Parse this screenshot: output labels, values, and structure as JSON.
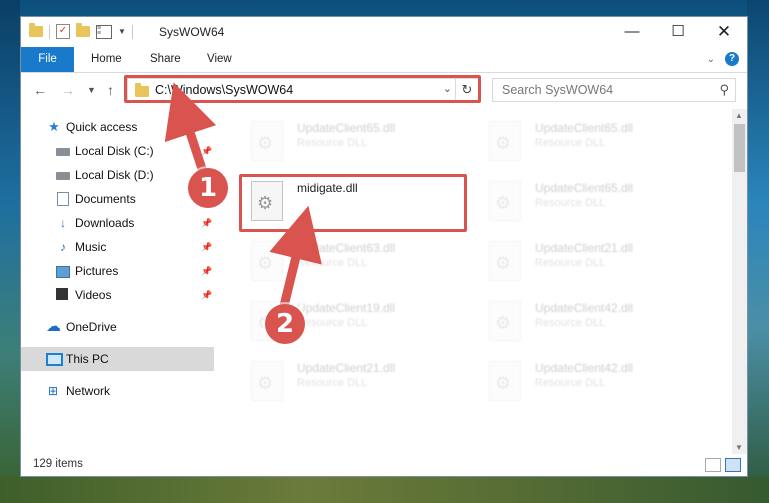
{
  "window": {
    "title": "SysWOW64",
    "controls": {
      "minimize": "—",
      "maximize": "☐",
      "close": "✕"
    }
  },
  "ribbon": {
    "tabs": [
      "File",
      "Home",
      "Share",
      "View"
    ]
  },
  "address_bar": {
    "path": "C:\\Windows\\SysWOW64",
    "search_placeholder": "Search SysWOW64"
  },
  "sidebar": {
    "quick_access": "Quick access",
    "items": [
      {
        "label": "Local Disk (C:)",
        "pinned": true
      },
      {
        "label": "Local Disk (D:)",
        "pinned": true
      },
      {
        "label": "Documents",
        "pinned": true
      },
      {
        "label": "Downloads",
        "pinned": true
      },
      {
        "label": "Music",
        "pinned": true
      },
      {
        "label": "Pictures",
        "pinned": true
      },
      {
        "label": "Videos",
        "pinned": true
      }
    ],
    "onedrive": "OneDrive",
    "this_pc": "This PC",
    "network": "Network"
  },
  "files": {
    "highlighted": {
      "name": "midigate.dll"
    },
    "background": [
      {
        "name": "UpdateClient65.dll",
        "type": "Resource DLL"
      },
      {
        "name": "UpdateClient65.dll",
        "type": "Resource DLL"
      },
      {
        "name": "UpdateClient65.dll",
        "type": "Resource DLL"
      },
      {
        "name": "UpdateClient63.dll",
        "type": "Resource DLL"
      },
      {
        "name": "UpdateClient21.dll",
        "type": "Resource DLL"
      },
      {
        "name": "UpdateClient19.dll",
        "type": "Resource DLL"
      },
      {
        "name": "UpdateClient42.dll",
        "type": "Resource DLL"
      },
      {
        "name": "UpdateClient21.dll",
        "type": "Resource DLL"
      },
      {
        "name": "UpdateClient42.dll",
        "type": "Resource DLL"
      }
    ]
  },
  "status": {
    "item_count": "129 items"
  },
  "annotations": {
    "badge1": "1",
    "badge2": "2",
    "color": "#d9534f"
  },
  "colors": {
    "accent": "#1979ca",
    "highlight": "#d9534f"
  }
}
